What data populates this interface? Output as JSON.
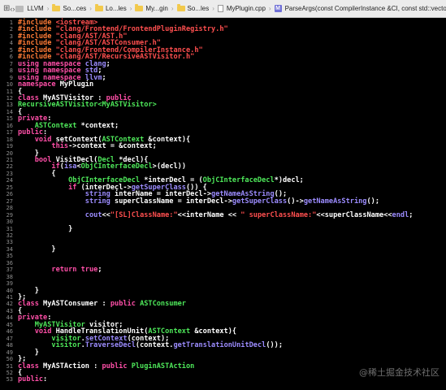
{
  "jumpbar": {
    "crumbs": [
      "LLVM",
      "So...ces",
      "Lo...les",
      "My...gin",
      "So...les",
      "MyPlugin.cpp",
      "ParseArgs(const CompilerInstance &CI, const std::vector<std::string>& args)"
    ]
  },
  "lines": [
    {
      "n": "1",
      "t": [
        [
          "pp",
          "#include "
        ],
        [
          "str",
          "<iostream>"
        ]
      ]
    },
    {
      "n": "2",
      "t": [
        [
          "pp",
          "#include "
        ],
        [
          "str",
          "\"clang/Frontend/FrontendPluginRegistry.h\""
        ]
      ]
    },
    {
      "n": "3",
      "t": [
        [
          "pp",
          "#include "
        ],
        [
          "str",
          "\"clang/AST/AST.h\""
        ]
      ]
    },
    {
      "n": "4",
      "t": [
        [
          "pp",
          "#include "
        ],
        [
          "str",
          "\"clang/AST/ASTConsumer.h\""
        ]
      ]
    },
    {
      "n": "5",
      "t": [
        [
          "pp",
          "#include "
        ],
        [
          "str",
          "\"clang/Frontend/CompilerInstance.h\""
        ]
      ]
    },
    {
      "n": "6",
      "t": [
        [
          "pp",
          "#include "
        ],
        [
          "str",
          "\"clang/AST/RecursiveASTVisitor.h\""
        ]
      ]
    },
    {
      "n": "7",
      "t": [
        [
          "kw",
          "using namespace "
        ],
        [
          "fn",
          "clang"
        ],
        [
          "plain",
          ";"
        ]
      ]
    },
    {
      "n": "8",
      "t": [
        [
          "kw",
          "using namespace "
        ],
        [
          "fn",
          "std"
        ],
        [
          "plain",
          ";"
        ]
      ]
    },
    {
      "n": "9",
      "t": [
        [
          "kw",
          "using namespace "
        ],
        [
          "fn",
          "llvm"
        ],
        [
          "plain",
          ";"
        ]
      ]
    },
    {
      "n": "10",
      "t": [
        [
          "kw",
          "namespace "
        ],
        [
          "plain",
          "MyPlugin"
        ]
      ]
    },
    {
      "n": "11",
      "t": [
        [
          "plain",
          "{"
        ]
      ]
    },
    {
      "n": "12",
      "t": [
        [
          "kw",
          "class "
        ],
        [
          "plain",
          "MyASTVisitor : "
        ],
        [
          "kw",
          "public"
        ]
      ]
    },
    {
      "n": "13",
      "t": [
        [
          "type",
          "RecursiveASTVisitor<MyASTVisitor>"
        ]
      ]
    },
    {
      "n": "14",
      "t": [
        [
          "plain",
          "{"
        ]
      ]
    },
    {
      "n": "15",
      "t": [
        [
          "kw",
          "private"
        ],
        [
          "plain",
          ":"
        ]
      ]
    },
    {
      "n": "16",
      "t": [
        [
          "plain",
          "    "
        ],
        [
          "type",
          "ASTContext"
        ],
        [
          "plain",
          " *context;"
        ]
      ]
    },
    {
      "n": "17",
      "t": [
        [
          "kw",
          "public"
        ],
        [
          "plain",
          ":"
        ]
      ]
    },
    {
      "n": "18",
      "t": [
        [
          "plain",
          "    "
        ],
        [
          "kw",
          "void "
        ],
        [
          "plain",
          "setContext("
        ],
        [
          "type",
          "ASTContext"
        ],
        [
          "plain",
          " &context){"
        ]
      ]
    },
    {
      "n": "19",
      "t": [
        [
          "plain",
          "        "
        ],
        [
          "kw",
          "this"
        ],
        [
          "plain",
          "->context = &context;"
        ]
      ]
    },
    {
      "n": "20",
      "t": [
        [
          "plain",
          "    }"
        ]
      ]
    },
    {
      "n": "21",
      "t": [
        [
          "plain",
          "    "
        ],
        [
          "kw",
          "bool "
        ],
        [
          "plain",
          "VisitDecl("
        ],
        [
          "type",
          "Decl"
        ],
        [
          "plain",
          " *decl){"
        ]
      ]
    },
    {
      "n": "22",
      "t": [
        [
          "plain",
          "        "
        ],
        [
          "kw",
          "if"
        ],
        [
          "plain",
          "("
        ],
        [
          "fn",
          "isa"
        ],
        [
          "plain",
          "<"
        ],
        [
          "type",
          "ObjCInterfaceDecl"
        ],
        [
          "plain",
          ">(decl))"
        ]
      ]
    },
    {
      "n": "23",
      "t": [
        [
          "plain",
          "        {"
        ]
      ]
    },
    {
      "n": "24",
      "t": [
        [
          "plain",
          "            "
        ],
        [
          "type",
          "ObjCInterfaceDecl"
        ],
        [
          "plain",
          " *interDecl = ("
        ],
        [
          "type",
          "ObjCInterfaceDecl"
        ],
        [
          "plain",
          "*)decl;"
        ]
      ]
    },
    {
      "n": "25",
      "t": [
        [
          "plain",
          "            "
        ],
        [
          "kw",
          "if "
        ],
        [
          "plain",
          "(interDecl->"
        ],
        [
          "fn",
          "getSuperClass"
        ],
        [
          "plain",
          "()) {"
        ]
      ]
    },
    {
      "n": "26",
      "t": [
        [
          "plain",
          "                "
        ],
        [
          "fn",
          "string"
        ],
        [
          "plain",
          " interName = interDecl->"
        ],
        [
          "fn",
          "getNameAsString"
        ],
        [
          "plain",
          "();"
        ]
      ]
    },
    {
      "n": "27",
      "t": [
        [
          "plain",
          "                "
        ],
        [
          "fn",
          "string"
        ],
        [
          "plain",
          " superClassName = interDecl->"
        ],
        [
          "fn",
          "getSuperClass"
        ],
        [
          "plain",
          "()->"
        ],
        [
          "fn",
          "getNameAsString"
        ],
        [
          "plain",
          "();"
        ]
      ]
    },
    {
      "n": "28",
      "t": []
    },
    {
      "n": "29",
      "t": [
        [
          "plain",
          "                "
        ],
        [
          "fn",
          "cout"
        ],
        [
          "plain",
          "<<"
        ],
        [
          "str",
          "\"[SL]ClassName:\""
        ],
        [
          "plain",
          "<<interName << "
        ],
        [
          "str",
          "\" superClassName:\""
        ],
        [
          "plain",
          "<<superClassName<<"
        ],
        [
          "fn",
          "endl"
        ],
        [
          "plain",
          ";"
        ]
      ]
    },
    {
      "n": "30",
      "t": []
    },
    {
      "n": "31",
      "t": [
        [
          "plain",
          "            }"
        ]
      ]
    },
    {
      "n": "32",
      "t": []
    },
    {
      "n": "33",
      "t": []
    },
    {
      "n": "34",
      "t": [
        [
          "plain",
          "        }"
        ]
      ]
    },
    {
      "n": "35",
      "t": []
    },
    {
      "n": "36",
      "t": []
    },
    {
      "n": "37",
      "t": [
        [
          "plain",
          "        "
        ],
        [
          "kw",
          "return true"
        ],
        [
          "plain",
          ";"
        ]
      ]
    },
    {
      "n": "38",
      "t": []
    },
    {
      "n": "39",
      "t": []
    },
    {
      "n": "40",
      "t": [
        [
          "plain",
          "    }"
        ]
      ]
    },
    {
      "n": "41",
      "t": [
        [
          "plain",
          "};"
        ]
      ]
    },
    {
      "n": "42",
      "t": [
        [
          "kw",
          "class "
        ],
        [
          "plain",
          "MyASTConsumer : "
        ],
        [
          "kw",
          "public "
        ],
        [
          "type",
          "ASTConsumer"
        ]
      ]
    },
    {
      "n": "43",
      "t": [
        [
          "plain",
          "{"
        ]
      ]
    },
    {
      "n": "44",
      "t": [
        [
          "kw",
          "private"
        ],
        [
          "plain",
          ":"
        ]
      ]
    },
    {
      "n": "45",
      "t": [
        [
          "plain",
          "    "
        ],
        [
          "type",
          "MyASTVisitor"
        ],
        [
          "plain",
          " visitor;"
        ]
      ]
    },
    {
      "n": "46",
      "t": [
        [
          "plain",
          "    "
        ],
        [
          "kw",
          "void "
        ],
        [
          "plain",
          "HandleTranslationUnit("
        ],
        [
          "type",
          "ASTContext"
        ],
        [
          "plain",
          " &context){"
        ]
      ]
    },
    {
      "n": "47",
      "t": [
        [
          "plain",
          "        "
        ],
        [
          "type",
          "visitor"
        ],
        [
          "plain",
          "."
        ],
        [
          "fn",
          "setContext"
        ],
        [
          "plain",
          "(context);"
        ]
      ]
    },
    {
      "n": "48",
      "t": [
        [
          "plain",
          "        "
        ],
        [
          "type",
          "visitor"
        ],
        [
          "plain",
          "."
        ],
        [
          "fn",
          "TraverseDecl"
        ],
        [
          "plain",
          "(context."
        ],
        [
          "fn",
          "getTranslationUnitDecl"
        ],
        [
          "plain",
          "());"
        ]
      ]
    },
    {
      "n": "49",
      "t": [
        [
          "plain",
          "    }"
        ]
      ]
    },
    {
      "n": "50",
      "t": [
        [
          "plain",
          "};"
        ]
      ]
    },
    {
      "n": "51",
      "t": [
        [
          "kw",
          "class "
        ],
        [
          "plain",
          "MyASTAction : "
        ],
        [
          "kw",
          "public "
        ],
        [
          "type",
          "PluginASTAction"
        ]
      ]
    },
    {
      "n": "52",
      "t": [
        [
          "plain",
          "{"
        ]
      ]
    },
    {
      "n": "53",
      "t": [
        [
          "kw",
          "public"
        ],
        [
          "plain",
          ":"
        ]
      ]
    }
  ],
  "watermark": "@稀土掘金技术社区"
}
